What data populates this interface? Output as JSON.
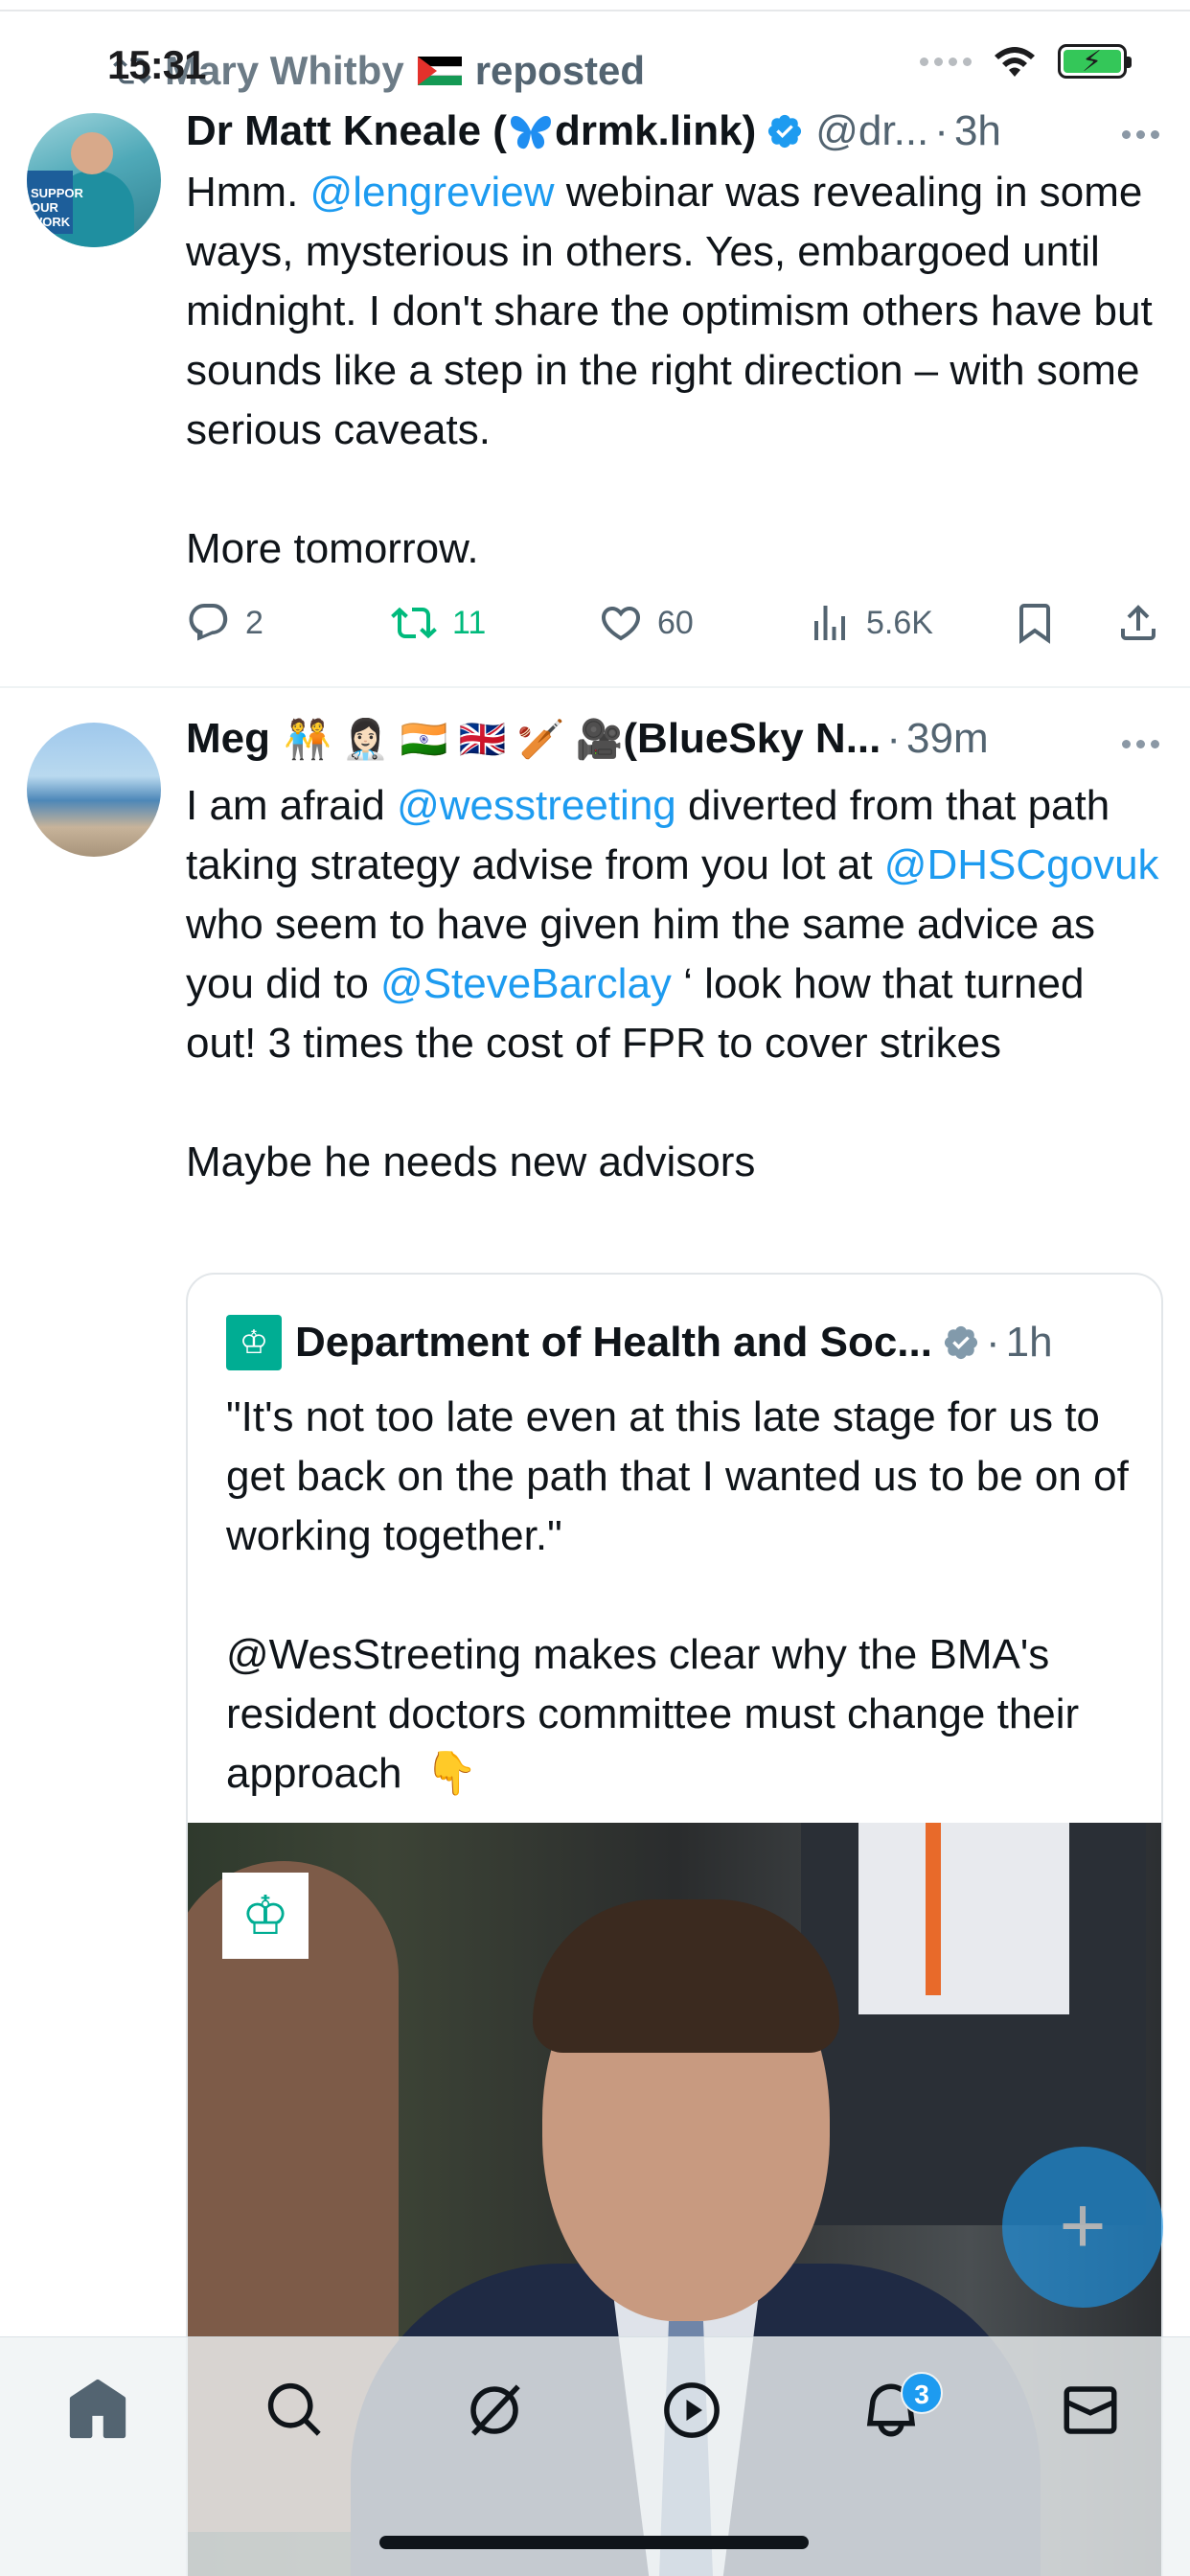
{
  "status_bar": {
    "time": "15:31"
  },
  "colors": {
    "accent": "#1d9bf0",
    "retweet_green": "#00ba7c",
    "secondary_text": "#536471"
  },
  "repost_banner": {
    "name": "Mary Whitby",
    "action": "reposted"
  },
  "tweets": [
    {
      "name": "Dr Matt Kneale (",
      "name_suffix": "drmk.link)",
      "handle": "@dr...",
      "time": "3h",
      "text": {
        "p1": "Hmm. ",
        "mention1": "@lengreview",
        "p2": " webinar was revealing in some ways, mysterious in others. Yes, embargoed until midnight. I don't share the optimism others have but sounds like a step in the right direction – with some serious caveats.\n\nMore tomorrow."
      },
      "actions": {
        "replies": "2",
        "reposts": "11",
        "likes": "60",
        "views": "5.6K"
      }
    },
    {
      "name": "Meg",
      "name_suffix": "(BlueSky N...",
      "time": "39m",
      "text": {
        "p1": "I am afraid ",
        "mention1": "@wesstreeting",
        "p2": " diverted from that path taking strategy advise from you lot at ",
        "mention2": "@DHSCgovuk",
        "p3": " who seem to have given him the same advice as you did to ",
        "mention3": "@SteveBarclay",
        "p4": " ‘ look how that turned out! 3 times the cost of FPR to cover strikes\n\nMaybe he needs new advisors"
      },
      "quote": {
        "name": "Department of Health and Soc...",
        "time": "1h",
        "text": "\"It's not too late even at this late stage for us to get back on the path that I wanted us to be on of working together.\"\n\n@WesStreeting makes clear why the BMA's resident doctors committee must change their approach  👇"
      }
    }
  ],
  "fab": {
    "label": "+"
  },
  "tabbar": {
    "items": [
      "home-icon",
      "search-icon",
      "grok-icon",
      "video-icon",
      "notifications-icon",
      "messages-icon"
    ],
    "notification_badge": "3"
  }
}
